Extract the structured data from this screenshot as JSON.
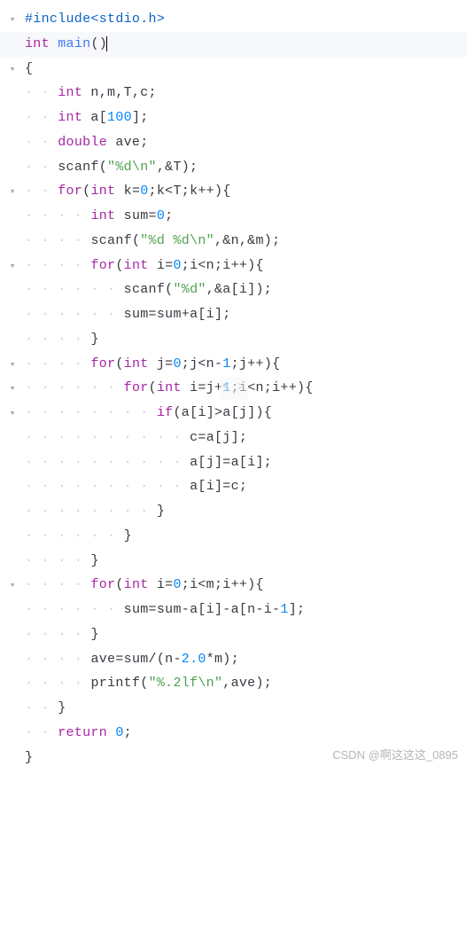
{
  "watermark": "CSDN @啊这这这_0895",
  "center_badge": "< >",
  "code": {
    "lines": [
      {
        "fold": true,
        "highlight": false,
        "indent": 0,
        "tokens": [
          {
            "t": "#include",
            "c": "pp"
          },
          {
            "t": "<stdio.h>",
            "c": "pp"
          }
        ]
      },
      {
        "fold": false,
        "highlight": true,
        "indent": 0,
        "tokens": [
          {
            "t": "int",
            "c": "typ"
          },
          {
            "t": " ",
            "c": "op"
          },
          {
            "t": "main",
            "c": "fn"
          },
          {
            "t": "()",
            "c": "op"
          },
          {
            "t": "",
            "c": "cursor"
          }
        ]
      },
      {
        "fold": true,
        "highlight": false,
        "indent": 0,
        "tokens": [
          {
            "t": "{",
            "c": "op"
          }
        ]
      },
      {
        "fold": false,
        "highlight": false,
        "indent": 0,
        "tokens": []
      },
      {
        "fold": false,
        "highlight": false,
        "indent": 1,
        "tokens": [
          {
            "t": "int",
            "c": "typ"
          },
          {
            "t": " n,m,T,c;",
            "c": "id"
          }
        ]
      },
      {
        "fold": false,
        "highlight": false,
        "indent": 1,
        "tokens": [
          {
            "t": "int",
            "c": "typ"
          },
          {
            "t": " a[",
            "c": "id"
          },
          {
            "t": "100",
            "c": "num"
          },
          {
            "t": "];",
            "c": "id"
          }
        ]
      },
      {
        "fold": false,
        "highlight": false,
        "indent": 1,
        "tokens": [
          {
            "t": "double",
            "c": "typ"
          },
          {
            "t": " ave;",
            "c": "id"
          }
        ]
      },
      {
        "fold": false,
        "highlight": false,
        "indent": 1,
        "tokens": [
          {
            "t": "scanf(",
            "c": "id"
          },
          {
            "t": "\"%d\\n\"",
            "c": "str"
          },
          {
            "t": ",&T);",
            "c": "id"
          }
        ]
      },
      {
        "fold": true,
        "highlight": false,
        "indent": 1,
        "tokens": [
          {
            "t": "for",
            "c": "kw"
          },
          {
            "t": "(",
            "c": "op"
          },
          {
            "t": "int",
            "c": "typ"
          },
          {
            "t": " k=",
            "c": "id"
          },
          {
            "t": "0",
            "c": "num"
          },
          {
            "t": ";k<T;k++){",
            "c": "id"
          }
        ]
      },
      {
        "fold": false,
        "highlight": false,
        "indent": 2,
        "tokens": [
          {
            "t": "int",
            "c": "typ"
          },
          {
            "t": " sum=",
            "c": "id"
          },
          {
            "t": "0",
            "c": "num"
          },
          {
            "t": ";",
            "c": "id"
          }
        ]
      },
      {
        "fold": false,
        "highlight": false,
        "indent": 2,
        "tokens": [
          {
            "t": "scanf(",
            "c": "id"
          },
          {
            "t": "\"%d %d\\n\"",
            "c": "str"
          },
          {
            "t": ",&n,&m);",
            "c": "id"
          }
        ]
      },
      {
        "fold": true,
        "highlight": false,
        "indent": 2,
        "tokens": [
          {
            "t": "for",
            "c": "kw"
          },
          {
            "t": "(",
            "c": "op"
          },
          {
            "t": "int",
            "c": "typ"
          },
          {
            "t": " i=",
            "c": "id"
          },
          {
            "t": "0",
            "c": "num"
          },
          {
            "t": ";i<n;i++){",
            "c": "id"
          }
        ]
      },
      {
        "fold": false,
        "highlight": false,
        "indent": 3,
        "tokens": [
          {
            "t": "scanf(",
            "c": "id"
          },
          {
            "t": "\"%d\"",
            "c": "str"
          },
          {
            "t": ",&a[i]);",
            "c": "id"
          }
        ]
      },
      {
        "fold": false,
        "highlight": false,
        "indent": 3,
        "tokens": [
          {
            "t": "sum=sum+a[i];",
            "c": "id"
          }
        ]
      },
      {
        "fold": false,
        "highlight": false,
        "indent": 2,
        "tokens": [
          {
            "t": "}",
            "c": "op"
          }
        ]
      },
      {
        "fold": true,
        "highlight": false,
        "indent": 2,
        "tokens": [
          {
            "t": "for",
            "c": "kw"
          },
          {
            "t": "(",
            "c": "op"
          },
          {
            "t": "int",
            "c": "typ"
          },
          {
            "t": " j=",
            "c": "id"
          },
          {
            "t": "0",
            "c": "num"
          },
          {
            "t": ";j<n-",
            "c": "id"
          },
          {
            "t": "1",
            "c": "num"
          },
          {
            "t": ";j++){",
            "c": "id"
          }
        ]
      },
      {
        "fold": true,
        "highlight": false,
        "indent": 3,
        "tokens": [
          {
            "t": "for",
            "c": "kw"
          },
          {
            "t": "(",
            "c": "op"
          },
          {
            "t": "int",
            "c": "typ"
          },
          {
            "t": " i=j+",
            "c": "id"
          },
          {
            "t": "1",
            "c": "num"
          },
          {
            "t": ";i<n;i++){",
            "c": "id"
          }
        ]
      },
      {
        "fold": true,
        "highlight": false,
        "indent": 4,
        "tokens": [
          {
            "t": "if",
            "c": "kw"
          },
          {
            "t": "(a[i]>a[j]){",
            "c": "id"
          }
        ]
      },
      {
        "fold": false,
        "highlight": false,
        "indent": 5,
        "tokens": [
          {
            "t": "c=a[j];",
            "c": "id"
          }
        ]
      },
      {
        "fold": false,
        "highlight": false,
        "indent": 5,
        "tokens": [
          {
            "t": "a[j]=a[i];",
            "c": "id"
          }
        ]
      },
      {
        "fold": false,
        "highlight": false,
        "indent": 5,
        "tokens": [
          {
            "t": "a[i]=c;",
            "c": "id"
          }
        ]
      },
      {
        "fold": false,
        "highlight": false,
        "indent": 4,
        "tokens": [
          {
            "t": "}",
            "c": "op"
          }
        ]
      },
      {
        "fold": false,
        "highlight": false,
        "indent": 3,
        "tokens": [
          {
            "t": "}",
            "c": "op"
          }
        ]
      },
      {
        "fold": false,
        "highlight": false,
        "indent": 2,
        "tokens": [
          {
            "t": "}",
            "c": "op"
          }
        ]
      },
      {
        "fold": true,
        "highlight": false,
        "indent": 2,
        "tokens": [
          {
            "t": "for",
            "c": "kw"
          },
          {
            "t": "(",
            "c": "op"
          },
          {
            "t": "int",
            "c": "typ"
          },
          {
            "t": " i=",
            "c": "id"
          },
          {
            "t": "0",
            "c": "num"
          },
          {
            "t": ";i<m;i++){",
            "c": "id"
          }
        ]
      },
      {
        "fold": false,
        "highlight": false,
        "indent": 3,
        "tokens": [
          {
            "t": "sum=sum-a[i]-a[n-i-",
            "c": "id"
          },
          {
            "t": "1",
            "c": "num"
          },
          {
            "t": "];",
            "c": "id"
          }
        ]
      },
      {
        "fold": false,
        "highlight": false,
        "indent": 2,
        "tokens": [
          {
            "t": "}",
            "c": "op"
          }
        ]
      },
      {
        "fold": false,
        "highlight": false,
        "indent": 2,
        "tokens": [
          {
            "t": "ave=sum/(n-",
            "c": "id"
          },
          {
            "t": "2.0",
            "c": "num"
          },
          {
            "t": "*m);",
            "c": "id"
          }
        ]
      },
      {
        "fold": false,
        "highlight": false,
        "indent": 2,
        "tokens": [
          {
            "t": "printf(",
            "c": "id"
          },
          {
            "t": "\"%.2lf\\n\"",
            "c": "str"
          },
          {
            "t": ",ave);",
            "c": "id"
          }
        ]
      },
      {
        "fold": false,
        "highlight": false,
        "indent": 1,
        "tokens": [
          {
            "t": "}",
            "c": "op"
          }
        ]
      },
      {
        "fold": false,
        "highlight": false,
        "indent": 1,
        "tokens": [
          {
            "t": "return",
            "c": "kw"
          },
          {
            "t": " ",
            "c": "op"
          },
          {
            "t": "0",
            "c": "num"
          },
          {
            "t": ";",
            "c": "id"
          }
        ]
      },
      {
        "fold": false,
        "highlight": false,
        "indent": 0,
        "tokens": [
          {
            "t": "}",
            "c": "op"
          }
        ]
      }
    ]
  }
}
